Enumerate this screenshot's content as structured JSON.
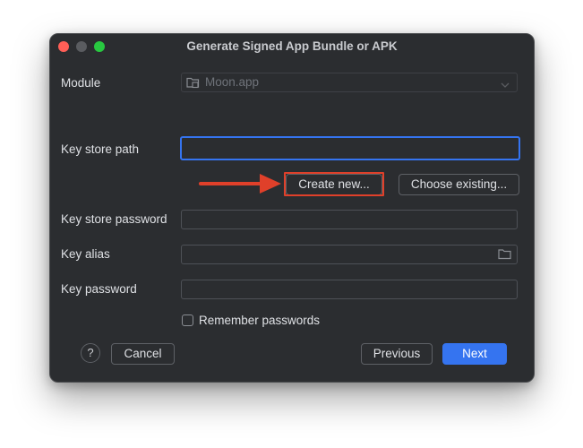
{
  "window": {
    "title": "Generate Signed App Bundle or APK"
  },
  "form": {
    "module_label": "Module",
    "module_value": "Moon.app",
    "key_store_path_label": "Key store path",
    "key_store_path_value": "",
    "create_new_label": "Create new...",
    "choose_existing_label": "Choose existing...",
    "key_store_password_label": "Key store password",
    "key_store_password_value": "",
    "key_alias_label": "Key alias",
    "key_alias_value": "",
    "key_password_label": "Key password",
    "key_password_value": "",
    "remember_passwords_label": "Remember passwords",
    "remember_passwords_checked": false
  },
  "footer": {
    "help_label": "?",
    "cancel_label": "Cancel",
    "previous_label": "Previous",
    "next_label": "Next"
  },
  "icons": {
    "module": "folder-module-icon",
    "dropdown": "chevron-down-icon",
    "browse": "folder-icon",
    "annotation": "arrow-right-icon"
  },
  "colors": {
    "background": "#2b2d30",
    "accent": "#3574f0",
    "annotation": "#e0402a",
    "text": "#dfe1e5"
  }
}
